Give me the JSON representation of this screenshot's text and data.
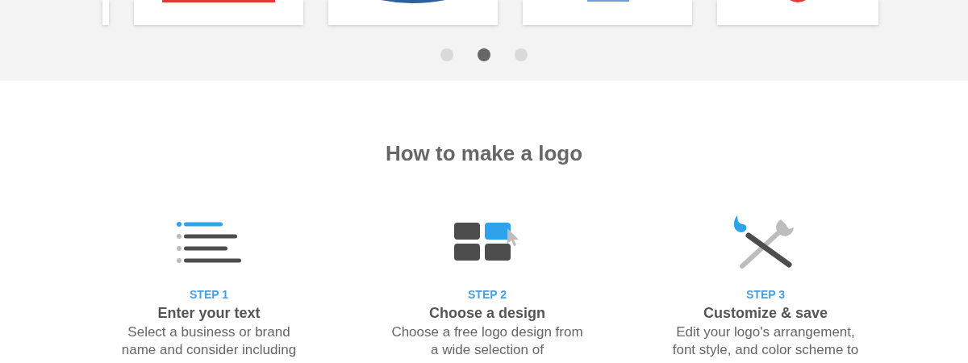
{
  "carousel": {
    "dots": [
      {
        "selected": false
      },
      {
        "selected": true
      },
      {
        "selected": false
      }
    ]
  },
  "how_to": {
    "title": "How to make a logo",
    "steps": [
      {
        "kind": "text",
        "step": "STEP 1",
        "title": "Enter your text",
        "description_lines": [
          "Select a business or brand",
          "name and consider including"
        ]
      },
      {
        "kind": "design",
        "step": "STEP 2",
        "title": "Choose a design",
        "description_lines": [
          "Choose a free logo design from",
          "a wide selection of"
        ]
      },
      {
        "kind": "tools",
        "step": "STEP 3",
        "title": "Customize & save",
        "description_lines": [
          "Edit your logo's arrangement,",
          "font style, and color scheme to"
        ]
      }
    ]
  }
}
